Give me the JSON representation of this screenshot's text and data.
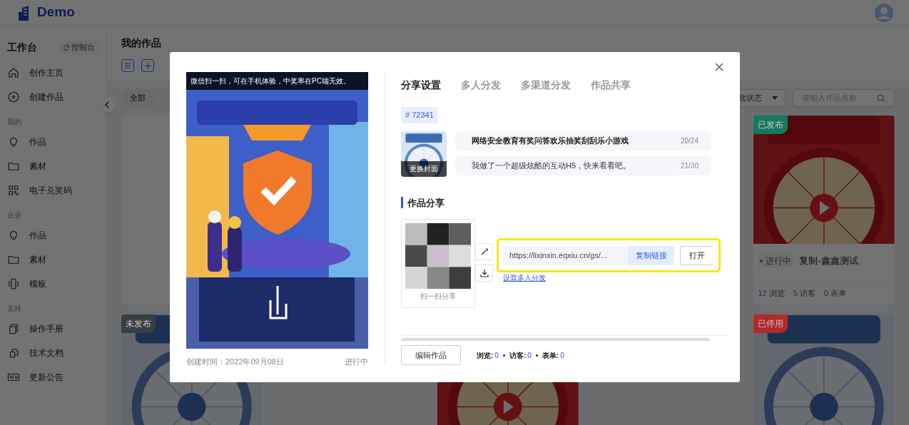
{
  "header": {
    "logo": "Demo"
  },
  "sidebar": {
    "title": "工作台",
    "console_button": "控制台",
    "sections": [
      {
        "items": [
          {
            "label": "创作主页",
            "kind": "home"
          },
          {
            "label": "创建作品",
            "kind": "plus"
          }
        ]
      },
      {
        "heading": "我的",
        "items": [
          {
            "label": "作品",
            "kind": "bulb"
          },
          {
            "label": "素材",
            "kind": "folder"
          },
          {
            "label": "电子兑奖码",
            "kind": "qr"
          }
        ]
      },
      {
        "heading": "企业",
        "items": [
          {
            "label": "作品",
            "kind": "bulb"
          },
          {
            "label": "素材",
            "kind": "folder"
          },
          {
            "label": "模板",
            "kind": "phone"
          }
        ]
      },
      {
        "heading": "支持",
        "items": [
          {
            "label": "操作手册",
            "kind": "copy"
          },
          {
            "label": "技术文档",
            "kind": "docs"
          },
          {
            "label": "更新公告",
            "kind": "new"
          }
        ]
      }
    ]
  },
  "main": {
    "title": "我的作品",
    "filter_chip": "全部",
    "status_select": "批状态",
    "search": {
      "placeholder": "请输入作品名称"
    },
    "rows": [
      {
        "cards": [
          {
            "kind": "blank"
          },
          {
            "kind": "red-full",
            "badge": "已发布",
            "color": "#137a60",
            "progress": "进行中",
            "title": "复制-鑫鑫测试",
            "stats": [
              {
                "number": "12",
                "unit": "浏览"
              },
              {
                "number": "5",
                "unit": "访客"
              },
              {
                "number": "0",
                "unit": "表单"
              }
            ]
          }
        ]
      },
      {
        "cards": [
          {
            "kind": "blue",
            "badge": "未发布",
            "color": "#3a3d42"
          },
          {
            "kind": "red"
          },
          {
            "kind": "blue",
            "badge": "已停用",
            "color": "#b02a2a"
          }
        ]
      }
    ]
  },
  "modal": {
    "preview": {
      "notice": "微信扫一扫，可在手机体验，中奖率在PC端无效。",
      "created": "创建时间：2022年09月08日",
      "status": "进行中"
    },
    "tabs": [
      {
        "label": "分享设置",
        "selected": true
      },
      {
        "label": "多人分发",
        "selected": false
      },
      {
        "label": "多渠道分发",
        "selected": false
      },
      {
        "label": "作品共享",
        "selected": false
      }
    ],
    "tag": "# 72341",
    "cover_button": "更换封面",
    "fields": [
      {
        "value": "网络安全教育有奖问答欢乐抽奖刮刮乐小游戏",
        "count": "20/24"
      },
      {
        "value": "我做了一个超级炫酷的互动H5，快来看看吧。",
        "count": "21/30"
      }
    ],
    "section_title": "作品分享",
    "qr_caption": "扫一扫分享",
    "link": {
      "url": "https://lixinxin.eqxiu.cn/gs/...",
      "copy_button": "复制链接",
      "open_button": "打开"
    },
    "multi_link": "设置多人分发",
    "edit_button": "编辑作品",
    "stats": [
      {
        "label": "浏览:",
        "value": "0"
      },
      {
        "label": "访客:",
        "value": "0"
      },
      {
        "label": "表单:",
        "value": "0"
      }
    ]
  }
}
